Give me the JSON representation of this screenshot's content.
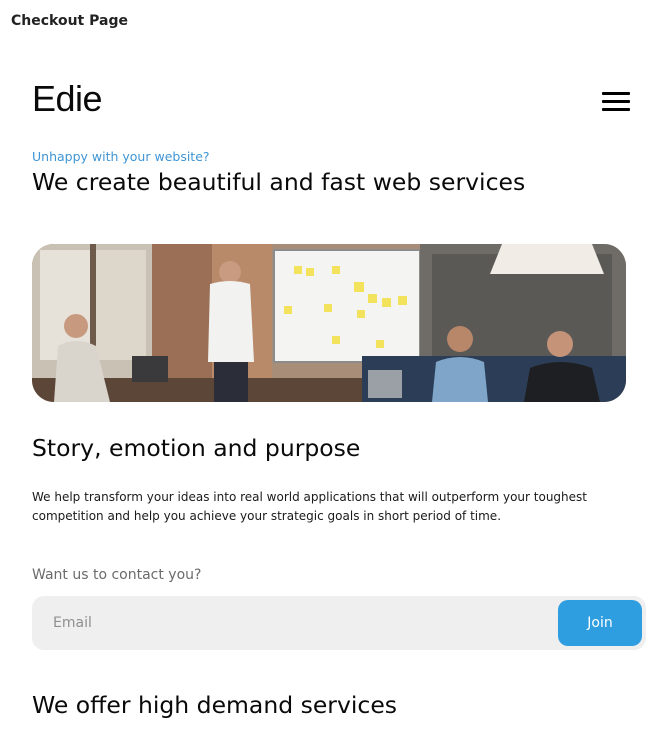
{
  "page_label": "Checkout Page",
  "header": {
    "logo": "Edie",
    "menu_icon": "hamburger-menu-icon"
  },
  "hero": {
    "eyebrow": "Unhappy with your website?",
    "title": "We create beautiful and fast web services"
  },
  "story": {
    "title": "Story, emotion and purpose",
    "body": "We help transform your ideas into real world applications that will outperform your toughest competition and help you achieve your strategic goals in short period of time."
  },
  "contact": {
    "label": "Want us to contact you?",
    "email_placeholder": "Email",
    "join_label": "Join"
  },
  "services": {
    "title": "We offer high demand services"
  },
  "colors": {
    "accent": "#2f9ee0",
    "eyebrow": "#3f95d4",
    "input_bg": "#efefef"
  }
}
